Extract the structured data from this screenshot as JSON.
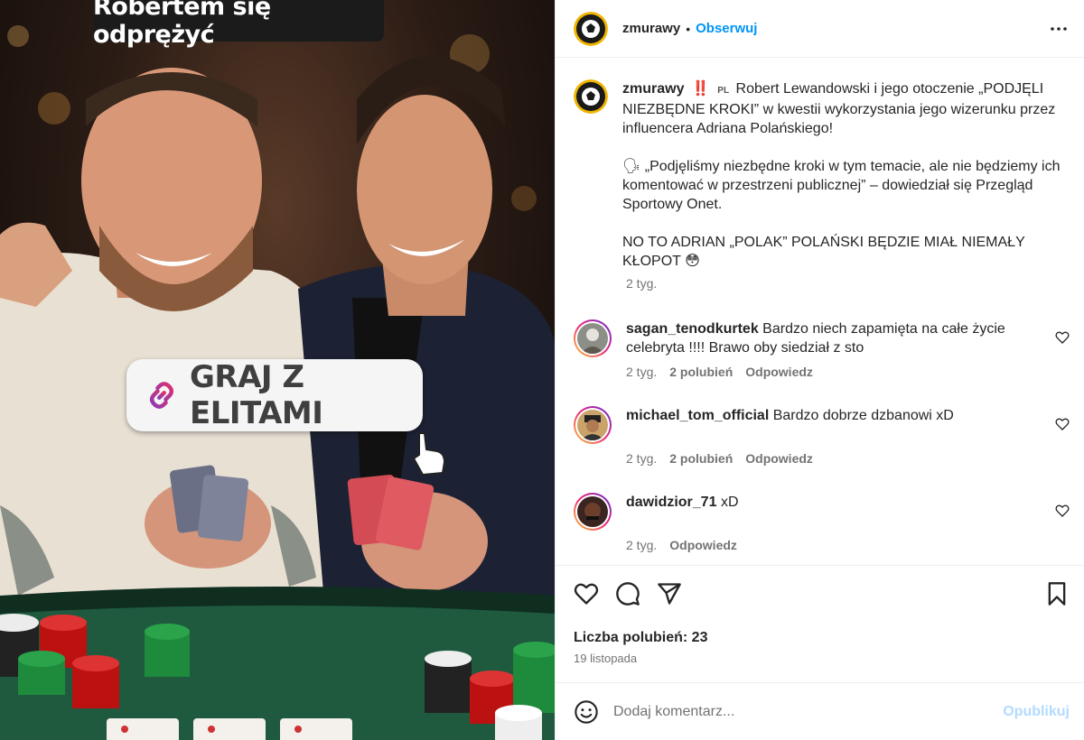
{
  "media": {
    "caption": "Robertem się odprężyć",
    "sticker_label": "GRAJ Z ELITAMI"
  },
  "header": {
    "username": "zmurawy",
    "separator": "•",
    "follow_label": "Obserwuj",
    "more_icon": "more-horizontal-icon"
  },
  "post": {
    "author": "zmurawy",
    "bang": "‼️",
    "lang_flag": "PL",
    "text_1": "Robert Lewandowski i jego otoczenie „PODJĘLI NIEZBĘDNE KROKI” w kwestii wykorzystania jego wizerunku przez influencera Adriana Polańskiego!",
    "text_2": "🗣 „Podjęliśmy niezbędne kroki w tym temacie, ale nie będziemy ich komentować w przestrzeni publicznej” – dowiedział się Przegląd Sportowy Onet.",
    "text_3": "NO TO ADRIAN „POLAK” POLAŃSKI BĘDZIE MIAŁ NIEMAŁY KŁOPOT 😳",
    "time": "2 tyg."
  },
  "comments": [
    {
      "user": "sagan_tenodkurtek",
      "text": "Bardzo niech zapamięta na całe życie celebryta !!!! Brawo oby siedział z sto",
      "time": "2 tyg.",
      "likes": "2 polubień",
      "reply": "Odpowiedz"
    },
    {
      "user": "michael_tom_official",
      "text": "Bardzo dobrze dzbanowi xD",
      "time": "2 tyg.",
      "likes": "2 polubień",
      "reply": "Odpowiedz"
    },
    {
      "user": "dawidzior_71",
      "text": "xD",
      "time": "2 tyg.",
      "reply": "Odpowiedz"
    }
  ],
  "footer": {
    "likes": "Liczba polubień: 23",
    "date": "19 listopada",
    "comment_placeholder": "Dodaj komentarz...",
    "publish_label": "Opublikuj"
  },
  "colors": {
    "accent": "#0095f6",
    "publish_disabled": "#b3dbff",
    "meta_gray": "#737373",
    "logo_yellow": "#f0b400"
  }
}
